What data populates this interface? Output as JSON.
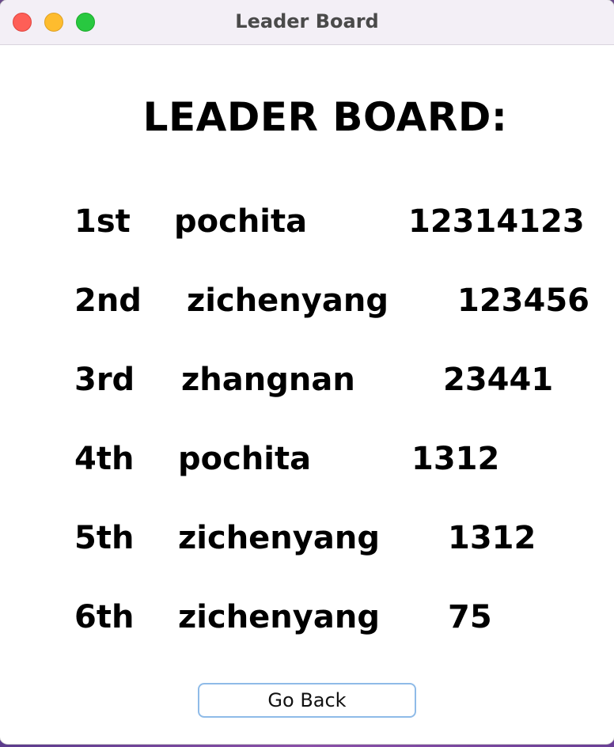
{
  "window": {
    "title": "Leader Board"
  },
  "board": {
    "heading": "LEADER BOARD:",
    "entries": [
      {
        "rank": "1st",
        "name": "pochita",
        "score": "12314123"
      },
      {
        "rank": "2nd",
        "name": "zichenyang",
        "score": "123456"
      },
      {
        "rank": "3rd",
        "name": "zhangnan",
        "score": "23441"
      },
      {
        "rank": "4th",
        "name": "pochita",
        "score": "1312"
      },
      {
        "rank": "5th",
        "name": "zichenyang",
        "score": "1312"
      },
      {
        "rank": "6th",
        "name": "zichenyang",
        "score": "75"
      }
    ]
  },
  "actions": {
    "go_back_label": "Go Back"
  },
  "colors": {
    "close": "#fe5f57",
    "minimize": "#febc2e",
    "maximize": "#28c840",
    "button_border": "#8fbbe8"
  }
}
